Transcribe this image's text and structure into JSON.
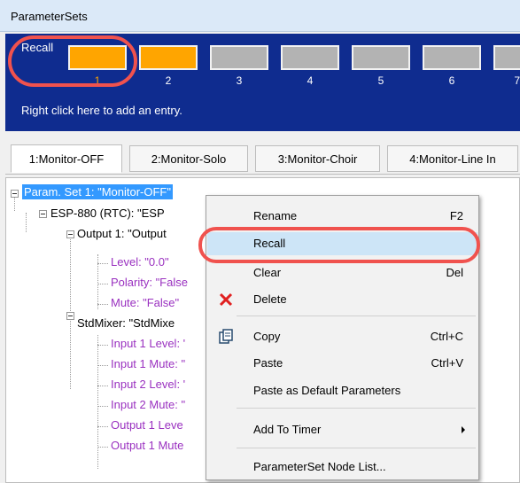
{
  "window": {
    "title": "ParameterSets"
  },
  "recall": {
    "label": "Recall",
    "slots": [
      {
        "num": "1",
        "active": true
      },
      {
        "num": "2",
        "active": true
      },
      {
        "num": "3",
        "active": false
      },
      {
        "num": "4",
        "active": false
      },
      {
        "num": "5",
        "active": false
      },
      {
        "num": "6",
        "active": false
      },
      {
        "num": "7",
        "active": false
      }
    ],
    "hint": "Right click here to add an entry."
  },
  "tabs": [
    {
      "label": "1:Monitor-OFF",
      "selected": true
    },
    {
      "label": "2:Monitor-Solo",
      "selected": false
    },
    {
      "label": "3:Monitor-Choir",
      "selected": false
    },
    {
      "label": "4:Monitor-Line In",
      "selected": false
    }
  ],
  "tree": [
    {
      "text": "Param. Set 1: \"Monitor-OFF\"",
      "level": 0,
      "expander": true,
      "selected": true,
      "leaf": false
    },
    {
      "text": "ESP-880 (RTC): \"ESP",
      "level": 1,
      "expander": true,
      "selected": false,
      "leaf": false
    },
    {
      "text": "Output 1: \"Output",
      "level": 2,
      "expander": true,
      "selected": false,
      "leaf": false
    },
    {
      "text": "Level: \"0.0\"",
      "level": 3,
      "expander": false,
      "selected": false,
      "leaf": true
    },
    {
      "text": "Polarity: \"False",
      "level": 3,
      "expander": false,
      "selected": false,
      "leaf": true
    },
    {
      "text": "Mute: \"False\"",
      "level": 3,
      "expander": false,
      "selected": false,
      "leaf": true
    },
    {
      "text": "StdMixer: \"StdMixe",
      "level": 2,
      "expander": true,
      "selected": false,
      "leaf": false
    },
    {
      "text": "Input 1 Level: '",
      "level": 3,
      "expander": false,
      "selected": false,
      "leaf": true
    },
    {
      "text": "Input 1 Mute: \"",
      "level": 3,
      "expander": false,
      "selected": false,
      "leaf": true
    },
    {
      "text": "Input 2 Level: '",
      "level": 3,
      "expander": false,
      "selected": false,
      "leaf": true
    },
    {
      "text": "Input 2 Mute: \"",
      "level": 3,
      "expander": false,
      "selected": false,
      "leaf": true
    },
    {
      "text": "Output 1 Leve",
      "level": 3,
      "expander": false,
      "selected": false,
      "leaf": true
    },
    {
      "text": "Output 1 Mute",
      "level": 3,
      "expander": false,
      "selected": false,
      "leaf": true
    }
  ],
  "menu": {
    "items": [
      {
        "label": "Rename",
        "shortcut": "F2",
        "icon": "",
        "hover": false
      },
      {
        "label": "Recall",
        "shortcut": "",
        "icon": "",
        "hover": true
      },
      {
        "label": "Clear",
        "shortcut": "Del",
        "icon": "",
        "hover": false
      },
      {
        "label": "Delete",
        "shortcut": "",
        "icon": "delete-x-icon",
        "hover": false
      },
      {
        "label": "Copy",
        "shortcut": "Ctrl+C",
        "icon": "copy-icon",
        "hover": false
      },
      {
        "label": "Paste",
        "shortcut": "Ctrl+V",
        "icon": "",
        "hover": false
      },
      {
        "label": "Paste as Default Parameters",
        "shortcut": "",
        "icon": "",
        "hover": false
      },
      {
        "label": "Add To Timer",
        "shortcut": "",
        "icon": "",
        "hover": false,
        "submenu": true
      },
      {
        "label": "ParameterSet Node List...",
        "shortcut": "",
        "icon": "",
        "hover": false
      }
    ]
  },
  "colors": {
    "panel": "#0f2c8f",
    "active_slot": "#ffa500",
    "inactive_slot": "#b3b3b3",
    "leaf_text": "#9a31c0",
    "selection": "#3399ff",
    "annotation": "#f0524e"
  }
}
